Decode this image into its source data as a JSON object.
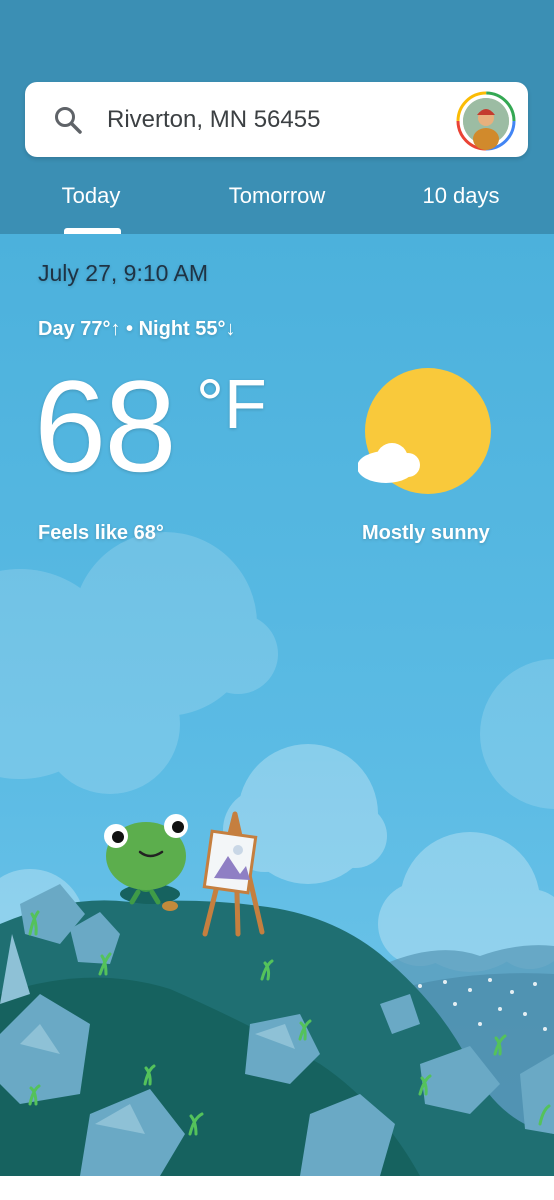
{
  "search": {
    "location": "Riverton, MN 56455"
  },
  "tabs": [
    {
      "label": "Today"
    },
    {
      "label": "Tomorrow"
    },
    {
      "label": "10 days"
    }
  ],
  "current": {
    "datetime": "July 27, 9:10 AM",
    "day_night": "Day 77°↑ • Night 55°↓",
    "temperature": "68",
    "unit": "°F",
    "feels_like": "Feels like 68°",
    "condition": "Mostly sunny"
  },
  "colors": {
    "header": "#3b8fb4",
    "sky": "#4aaed8",
    "sun": "#f9c93b",
    "hill": "#1d6e74"
  },
  "icons": [
    "search-icon",
    "account-avatar",
    "mostly-sunny-icon",
    "frog-mascot"
  ]
}
